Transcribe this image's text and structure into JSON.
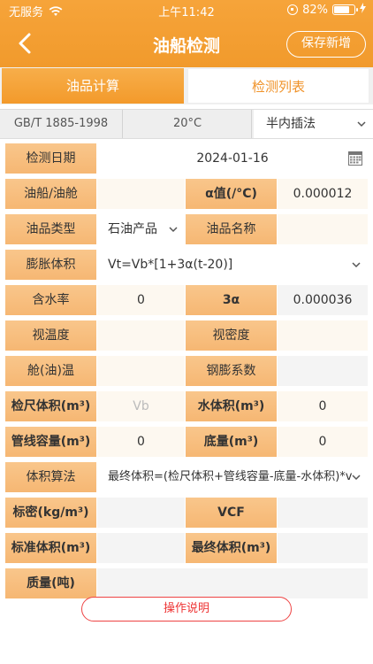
{
  "status": {
    "carrier": "无服务",
    "time": "上午11:42",
    "battery": "82%",
    "battery_level": 0.82
  },
  "nav": {
    "title": "油船检测",
    "save": "保存新增"
  },
  "tabs": [
    {
      "label": "油品计算",
      "active": true
    },
    {
      "label": "检测列表",
      "active": false
    }
  ],
  "standards": {
    "std": "GB/T 1885-1998",
    "temp": "20°C",
    "method": "半内插法"
  },
  "form": {
    "date_label": "检测日期",
    "date_value": "2024-01-16",
    "ship_label": "油船/油舱",
    "alpha_label": "α值(/°C)",
    "alpha_value": "0.000012",
    "type_label": "油品类型",
    "type_value": "石油产品",
    "name_label": "油品名称",
    "expand_label": "膨胀体积",
    "expand_value": "Vt=Vb*[1+3α(t-20)]",
    "water_label": "含水率",
    "water_value": "0",
    "three_alpha_label": "3α",
    "three_alpha_value": "0.000036",
    "view_temp_label": "视温度",
    "view_density_label": "视密度",
    "tank_temp_label": "舱(油)温",
    "steel_label": "钢膨系数",
    "gauge_label": "检尺体积(m³)",
    "gauge_placeholder": "Vb",
    "water_vol_label": "水体积(m³)",
    "water_vol_value": "0",
    "pipe_label": "管线容量(m³)",
    "pipe_value": "0",
    "bottom_label": "底量(m³)",
    "bottom_value": "0",
    "algo_label": "体积算法",
    "algo_value": "最终体积=(检尺体积+管线容量-底量-水体积)*v",
    "std_density_label": "标密(kg/m³)",
    "vcf_label": "VCF",
    "std_vol_label": "标准体积(m³)",
    "final_vol_label": "最终体积(m³)",
    "mass_label": "质量(吨)"
  },
  "help": "操作说明",
  "colors": {
    "brand": "#f19a2c",
    "label_bg": "#f6b773",
    "help_red": "#e33333"
  }
}
